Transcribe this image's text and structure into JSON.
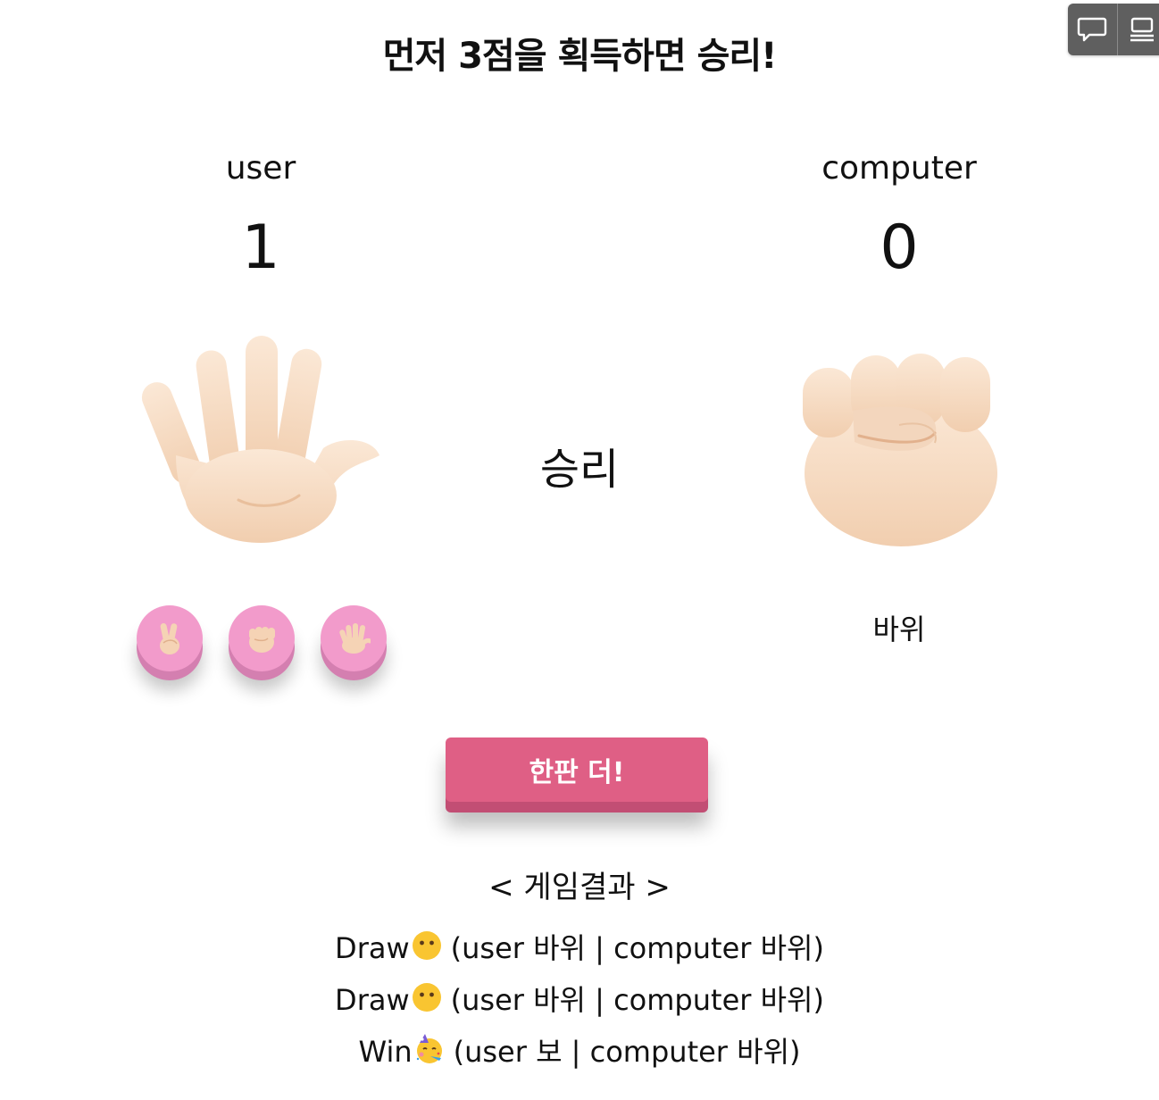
{
  "title": "먼저 3점을 획득하면 승리!",
  "user": {
    "name": "user",
    "score": "1",
    "hand": "paper-hand-icon"
  },
  "computer": {
    "name": "computer",
    "score": "0",
    "hand": "rock-fist-icon",
    "choice_label": "바위"
  },
  "round_result": "승리",
  "choices": [
    {
      "icon": "scissors-hand-icon"
    },
    {
      "icon": "rock-fist-icon"
    },
    {
      "icon": "paper-hand-icon"
    }
  ],
  "again_button": "한판 더!",
  "history_title": "< 게임결과 >",
  "history": [
    {
      "result": "Draw",
      "emoji": "neutral-face-icon",
      "detail": "(user 바위 | computer 바위)"
    },
    {
      "result": "Draw",
      "emoji": "neutral-face-icon",
      "detail": "(user 바위 | computer 바위)"
    },
    {
      "result": "Win",
      "emoji": "party-face-icon",
      "detail": "(user 보 | computer 바위)"
    }
  ],
  "colors": {
    "choice_button": "#f29bcb",
    "choice_button_shadow": "#d47fb0",
    "again_button": "#df5f85",
    "again_button_shadow": "#c24e74",
    "skin": "#f7dcc3",
    "widget": "#5f5f5f"
  }
}
